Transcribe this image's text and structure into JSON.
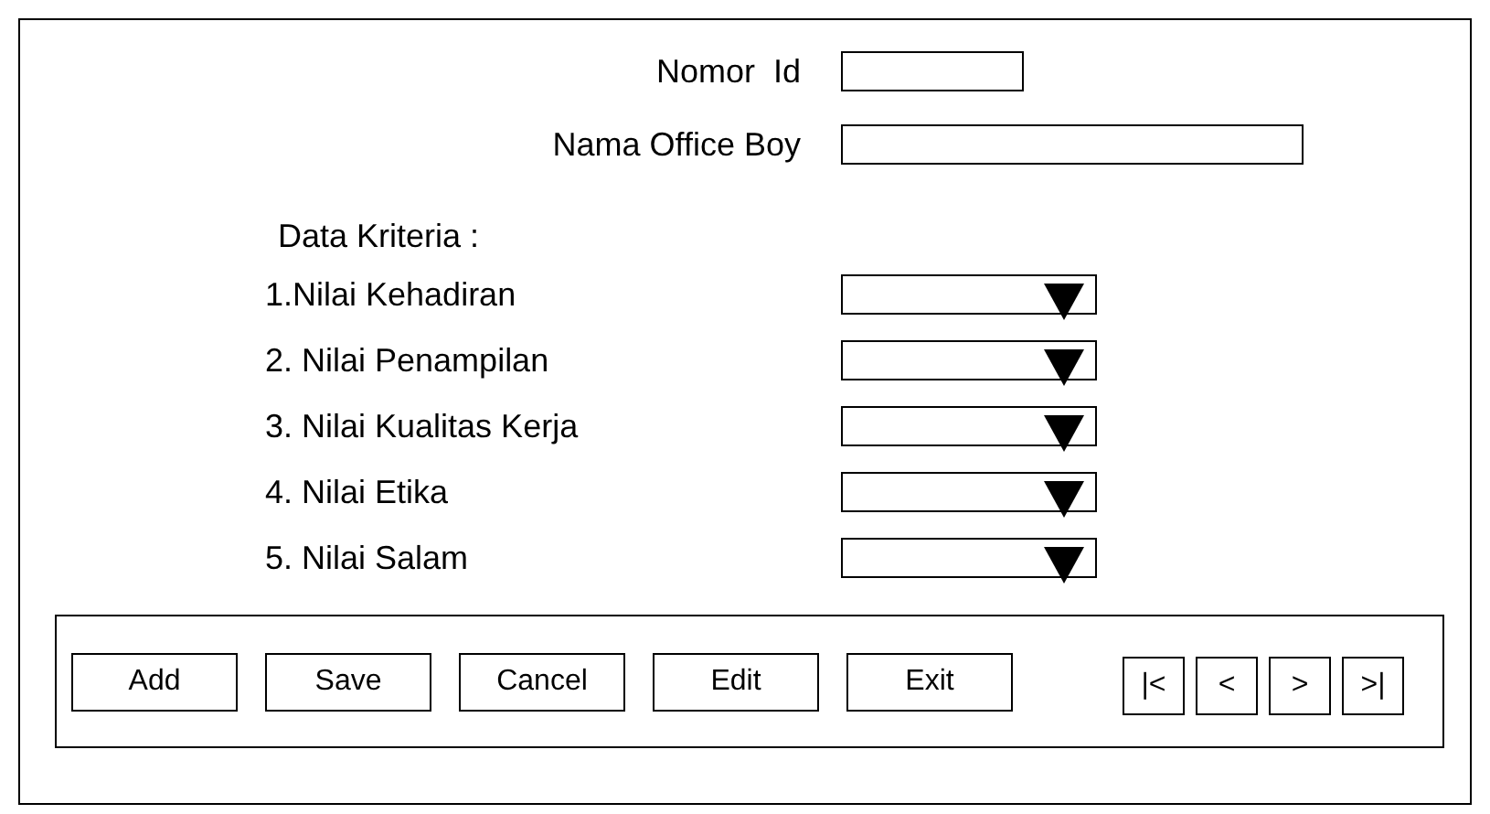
{
  "fields": [
    {
      "label": "Nomor  Id",
      "kind": "short"
    },
    {
      "label": "Nama Office Boy",
      "kind": "long"
    }
  ],
  "criteria": {
    "title": "Data Kriteria :",
    "items": [
      {
        "label": "1.Nilai Kehadiran"
      },
      {
        "label": "2. Nilai Penampilan"
      },
      {
        "label": "3. Nilai Kualitas Kerja"
      },
      {
        "label": "4. Nilai Etika"
      },
      {
        "label": "5. Nilai Salam"
      }
    ]
  },
  "buttons": [
    "Add",
    "Save",
    "Cancel",
    "Edit",
    "Exit"
  ],
  "navigation": [
    "|<",
    "<",
    ">",
    ">|"
  ]
}
